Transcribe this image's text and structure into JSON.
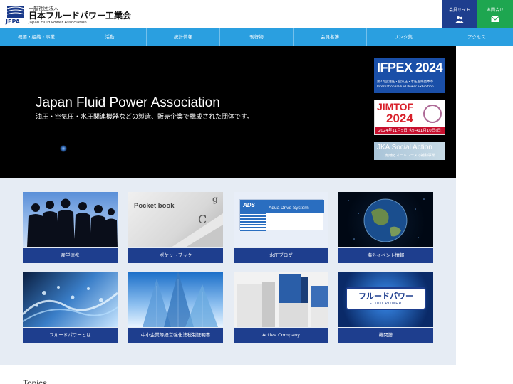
{
  "header": {
    "logo": {
      "abbr": "JFPA",
      "small": "一般社団法人",
      "main": "日本フルードパワー工業会",
      "en": "Japan Fluid Power Association"
    },
    "member_site": "会員サイト",
    "contact": "お問合せ",
    "colors": {
      "member": "#1e3e8e",
      "contact": "#1ea650",
      "nav": "#2a9fe0"
    }
  },
  "nav": [
    "概要・組織・事業",
    "活動",
    "統計情報",
    "刊行物",
    "会員名簿",
    "リンク集",
    "アクセス"
  ],
  "hero": {
    "title": "Japan Fluid Power Association",
    "subtitle": "油圧・空気圧・水圧関連機器などの製造、販売企業で構成された団体です。"
  },
  "banners": {
    "ifpex": {
      "title": "IFPEX 2024",
      "line1": "第27回 油圧・空気圧・水圧国際見本市",
      "line2": "International Fluid Power Exhibition"
    },
    "jimtof": {
      "title1": "JIMTOF",
      "title2": "2024",
      "dates": "2024年11月5日(火)→11月10日(日)"
    },
    "jka": {
      "title": "JKA Social Action",
      "sub": "競輪とオートレースの補助事業"
    }
  },
  "tiles": [
    {
      "label": "産学連携",
      "icon": "business-people-icon"
    },
    {
      "label": "ポケットブック",
      "image_text": "Pocket book",
      "icon": "document-icon"
    },
    {
      "label": "水圧ブログ",
      "image_logo": "ADS",
      "image_title": "Aqua Drive System",
      "icon": "water-icon"
    },
    {
      "label": "海外イベント情報",
      "icon": "globe-icon"
    },
    {
      "label": "フルードパワーとは",
      "icon": "water-splash-icon"
    },
    {
      "label": "中小企業等経営強化法税制証明書",
      "icon": "building-icon"
    },
    {
      "label": "Active Company",
      "icon": "cube-icon"
    },
    {
      "label": "機関誌",
      "image_title": "フルードパワー",
      "image_sub": "FLUID POWER",
      "icon": "magazine-icon"
    }
  ],
  "topics": {
    "title": "Topics"
  }
}
